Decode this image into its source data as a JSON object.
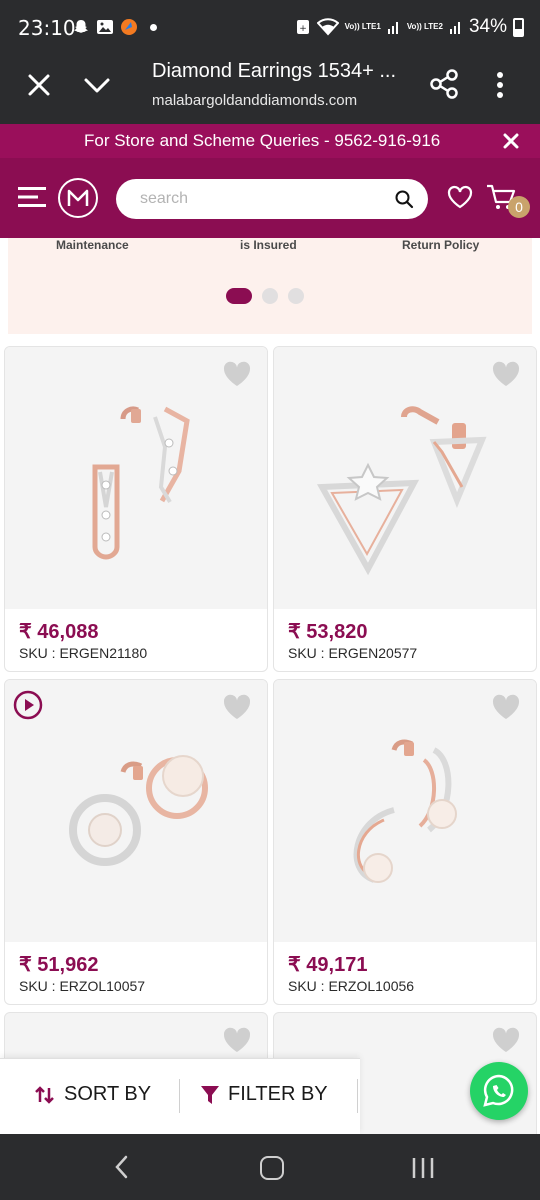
{
  "status_bar": {
    "time": "23:10",
    "battery": "34%",
    "net1": "Vo)) LTE1",
    "net2": "Vo)) LTE2"
  },
  "browser": {
    "title": "Diamond Earrings 1534+ ...",
    "url": "malabargoldanddiamonds.com"
  },
  "promo": {
    "text": "For Store and Scheme Queries - 9562-916-916"
  },
  "header": {
    "search_placeholder": "search",
    "cart_count": "0"
  },
  "info_strip": {
    "labels": [
      "Maintenance",
      "is Insured",
      "Return Policy"
    ],
    "carousel_pages": 3,
    "active_page": 1
  },
  "products": [
    {
      "price": "₹ 46,088",
      "sku": "SKU : ERGEN21180",
      "has_video": false
    },
    {
      "price": "₹ 53,820",
      "sku": "SKU : ERGEN20577",
      "has_video": false
    },
    {
      "price": "₹ 51,962",
      "sku": "SKU : ERZOL10057",
      "has_video": true
    },
    {
      "price": "₹ 49,171",
      "sku": "SKU : ERZOL10056",
      "has_video": false
    }
  ],
  "actions": {
    "sort_label": "SORT BY",
    "filter_label": "FILTER BY"
  },
  "colors": {
    "brand": "#8b0d52",
    "promo": "#9a0f5b",
    "whatsapp": "#25d366",
    "badge": "#c9a36b"
  }
}
